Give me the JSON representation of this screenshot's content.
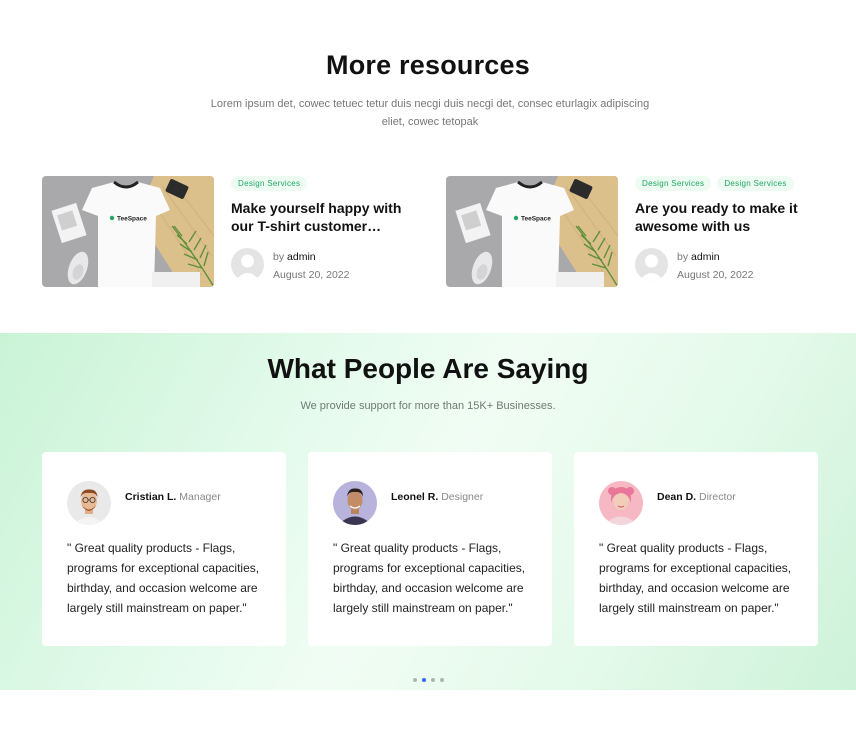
{
  "resources": {
    "title": "More resources",
    "subtitle": "Lorem ipsum det, cowec tetuec tetur duis necgi duis necgi det, consec eturlagix adipiscing eliet, cowec tetopak",
    "posts": [
      {
        "tags": [
          "Design Services"
        ],
        "title": "Make yourself happy with our T-shirt customer…",
        "by_label": "by",
        "author": "admin",
        "date": "August 20, 2022",
        "image_brand": "TeeSpace"
      },
      {
        "tags": [
          "Design Services",
          "Design Services"
        ],
        "title": "Are you ready to make it awesome with us",
        "by_label": "by",
        "author": "admin",
        "date": "August 20, 2022",
        "image_brand": "TeeSpace"
      }
    ]
  },
  "testimonials": {
    "title": "What People Are Saying",
    "subtitle": "We provide support for more than 15K+ Businesses.",
    "items": [
      {
        "name": "Cristian L.",
        "role": "Manager",
        "quote": "\" Great quality products - Flags, programs for exceptional capacities, birthday, and occasion welcome are largely still mainstream on paper.\""
      },
      {
        "name": "Leonel R.",
        "role": "Designer",
        "quote": "\" Great quality products - Flags, programs for exceptional capacities, birthday, and occasion welcome are largely still mainstream on paper.\""
      },
      {
        "name": "Dean D.",
        "role": "Director",
        "quote": "\" Great quality products - Flags, programs for exceptional capacities, birthday, and occasion welcome are largely still mainstream on paper.\""
      }
    ],
    "carousel": {
      "total": 4,
      "active": 1
    }
  },
  "colors": {
    "accent_green": "#1fa862",
    "tag_bg": "#eefbf3",
    "active_dot": "#2b6cf0"
  }
}
